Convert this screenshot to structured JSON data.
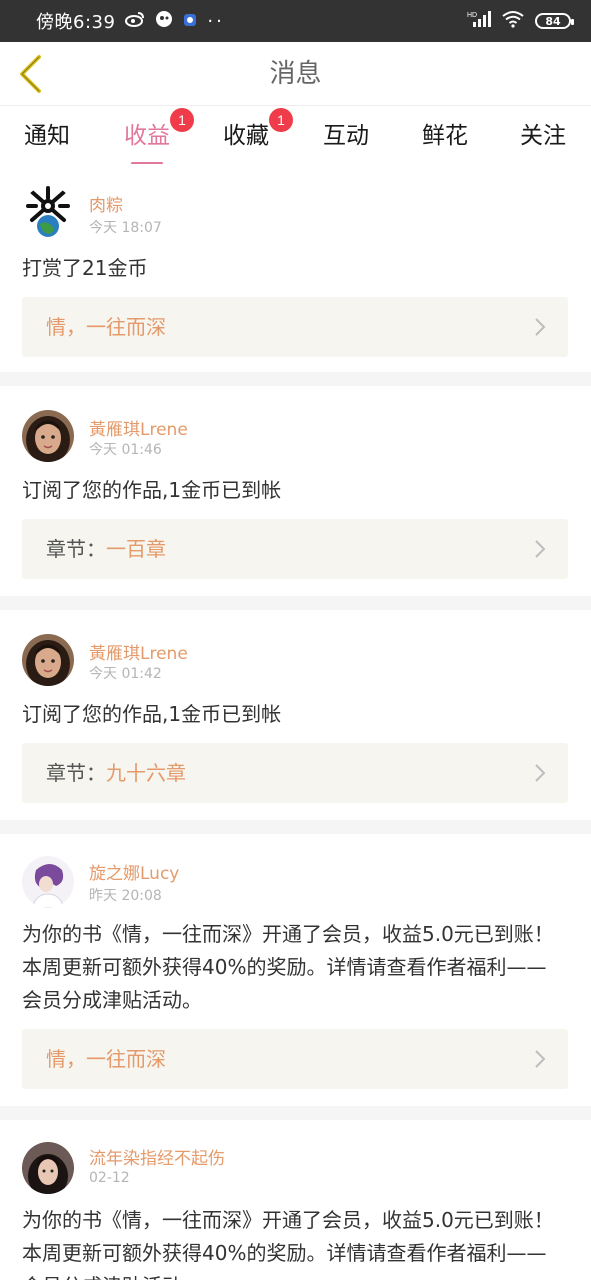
{
  "status_bar": {
    "time": "傍晚6:39",
    "network": "HD",
    "battery": "84"
  },
  "header": {
    "title": "消息"
  },
  "tabs": [
    {
      "label": "通知",
      "badge": null,
      "active": false
    },
    {
      "label": "收益",
      "badge": "1",
      "active": true
    },
    {
      "label": "收藏",
      "badge": "1",
      "active": false
    },
    {
      "label": "互动",
      "badge": null,
      "active": false
    },
    {
      "label": "鲜花",
      "badge": null,
      "active": false
    },
    {
      "label": "关注",
      "badge": null,
      "active": false
    }
  ],
  "messages": [
    {
      "user": "肉粽",
      "time": "今天 18:07",
      "text": "打赏了21金币",
      "link_prefix": "",
      "link_text": "情，一往而深"
    },
    {
      "user": "黃雁琪Lrene",
      "time": "今天 01:46",
      "text": "订阅了您的作品,1金币已到帐",
      "link_prefix": "章节：",
      "link_text": "一百章"
    },
    {
      "user": "黃雁琪Lrene",
      "time": "今天 01:42",
      "text": "订阅了您的作品,1金币已到帐",
      "link_prefix": "章节：",
      "link_text": "九十六章"
    },
    {
      "user": "旋之娜Lucy",
      "time": "昨天 20:08",
      "text": "为你的书《情，一往而深》开通了会员，收益5.0元已到账！本周更新可额外获得40%的奖励。详情请查看作者福利——会员分成津贴活动。",
      "link_prefix": "",
      "link_text": "情，一往而深"
    },
    {
      "user": "流年染指经不起伤",
      "time": "02-12",
      "text": "为你的书《情，一往而深》开通了会员，收益5.0元已到账！本周更新可额外获得40%的奖励。详情请查看作者福利——会员分成津贴活动。",
      "link_prefix": "",
      "link_text": ""
    }
  ],
  "colors": {
    "accent": "#e2779c",
    "username": "#e49a6a",
    "badge": "#ef3b4a",
    "link_bg": "#f6f5ef",
    "back_arrow": "#d9c21e"
  }
}
